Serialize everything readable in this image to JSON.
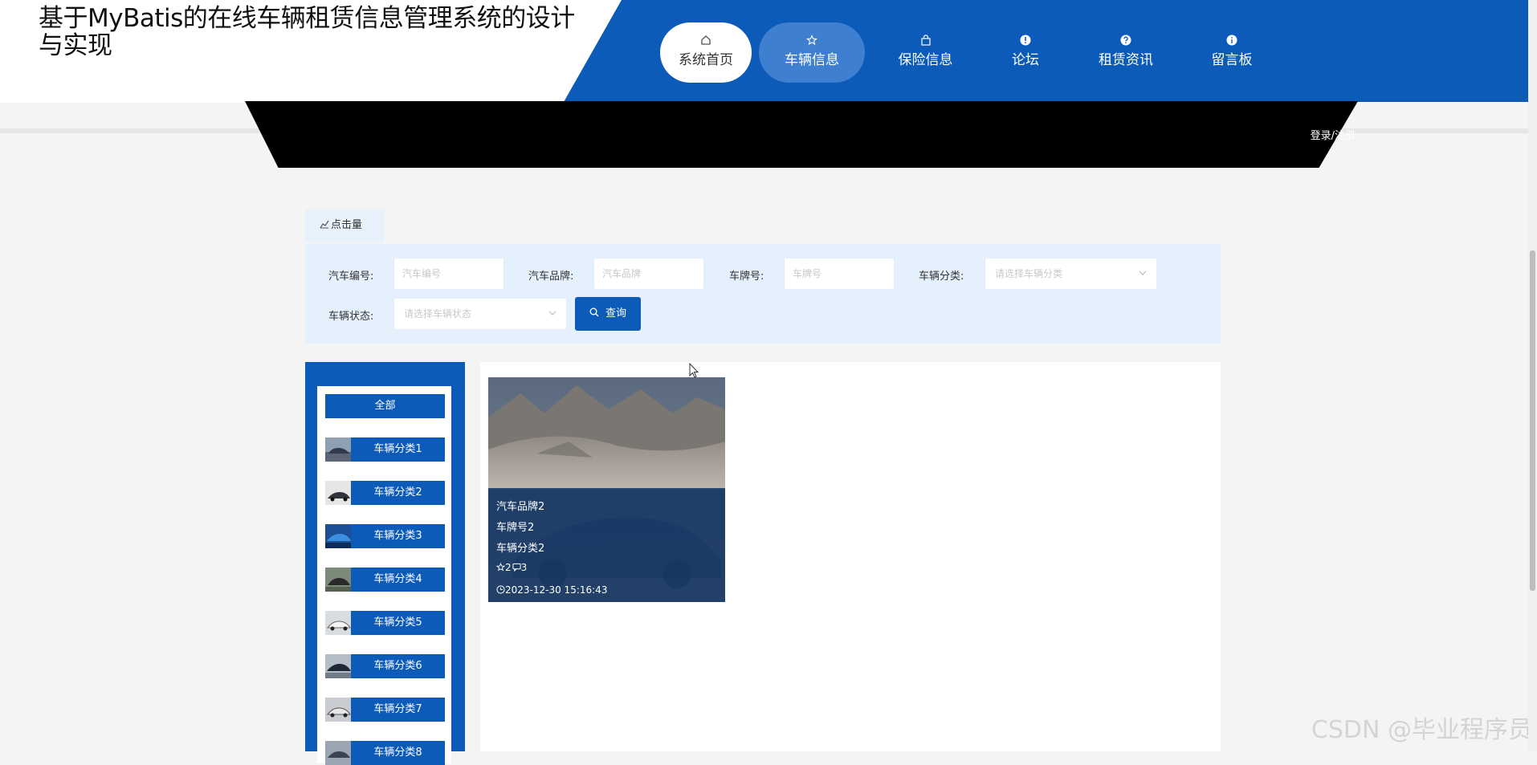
{
  "site": {
    "title": "基于MyBatis的在线车辆租赁信息管理系统的设计与实现"
  },
  "nav": {
    "items": [
      {
        "label": "系统首页",
        "icon": "home-icon"
      },
      {
        "label": "车辆信息",
        "icon": "star-icon"
      },
      {
        "label": "保险信息",
        "icon": "bag-icon"
      },
      {
        "label": "论坛",
        "icon": "exclamation-icon"
      },
      {
        "label": "租赁资讯",
        "icon": "question-icon"
      },
      {
        "label": "留言板",
        "icon": "info-icon"
      }
    ],
    "active": "车辆信息"
  },
  "header": {
    "login_label": "登录/注册"
  },
  "sort_tab": {
    "label": "点击量",
    "icon": "chart-icon"
  },
  "search": {
    "car_no_label": "汽车编号:",
    "car_no_placeholder": "汽车编号",
    "brand_label": "汽车品牌:",
    "brand_placeholder": "汽车品牌",
    "plate_label": "车牌号:",
    "plate_placeholder": "车牌号",
    "category_label": "车辆分类:",
    "category_placeholder": "请选择车辆分类",
    "status_label": "车辆状态:",
    "status_placeholder": "请选择车辆状态",
    "query_label": "查询"
  },
  "categories": {
    "all_label": "全部",
    "items": [
      {
        "label": "车辆分类1"
      },
      {
        "label": "车辆分类2"
      },
      {
        "label": "车辆分类3"
      },
      {
        "label": "车辆分类4"
      },
      {
        "label": "车辆分类5"
      },
      {
        "label": "车辆分类6"
      },
      {
        "label": "车辆分类7"
      },
      {
        "label": "车辆分类8"
      }
    ]
  },
  "cards": [
    {
      "brand": "汽车品牌2",
      "plate": "车牌号2",
      "category": "车辆分类2",
      "likes": "2",
      "comments": "3",
      "time": "2023-12-30 15:16:43"
    }
  ],
  "watermark": "CSDN @毕业程序员",
  "colors": {
    "primary": "#0c5bb8",
    "search_bg": "#e4f0fc",
    "banner": "#000000"
  }
}
